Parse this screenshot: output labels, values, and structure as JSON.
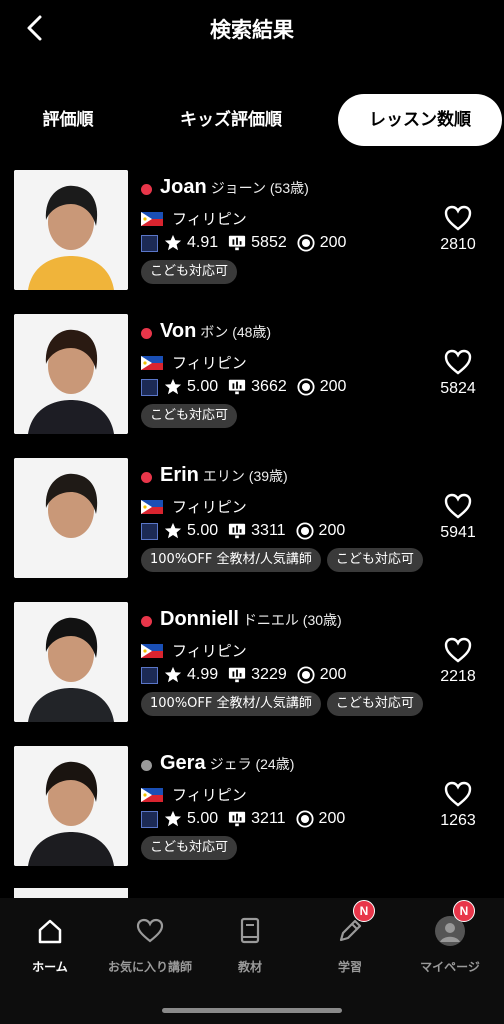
{
  "header": {
    "title": "検索結果"
  },
  "tabs": [
    {
      "label": "評価順"
    },
    {
      "label": "キッズ評価順"
    },
    {
      "label": "レッスン数順"
    }
  ],
  "colors": {
    "online": "#e8364a",
    "offline": "#9a9a9a",
    "active_tab_bg": "#ffffff"
  },
  "teachers": [
    {
      "name": "Joan",
      "kana": "ジョーン",
      "age": "(53歳)",
      "status": "online",
      "country": "フィリピン",
      "rating": "4.91",
      "lessons": "5852",
      "coins": "200",
      "tags": [
        "こども対応可"
      ],
      "favorites": "2810"
    },
    {
      "name": "Von",
      "kana": "ボン",
      "age": "(48歳)",
      "status": "online",
      "country": "フィリピン",
      "rating": "5.00",
      "lessons": "3662",
      "coins": "200",
      "tags": [
        "こども対応可"
      ],
      "favorites": "5824"
    },
    {
      "name": "Erin",
      "kana": "エリン",
      "age": "(39歳)",
      "status": "online",
      "country": "フィリピン",
      "rating": "5.00",
      "lessons": "3311",
      "coins": "200",
      "tags": [
        "100%OFF 全教材/人気講師",
        "こども対応可"
      ],
      "favorites": "5941"
    },
    {
      "name": "Donniell",
      "kana": "ドニエル",
      "age": "(30歳)",
      "status": "online",
      "country": "フィリピン",
      "rating": "4.99",
      "lessons": "3229",
      "coins": "200",
      "tags": [
        "100%OFF 全教材/人気講師",
        "こども対応可"
      ],
      "favorites": "2218"
    },
    {
      "name": "Gera",
      "kana": "ジェラ",
      "age": "(24歳)",
      "status": "offline",
      "country": "フィリピン",
      "rating": "5.00",
      "lessons": "3211",
      "coins": "200",
      "tags": [
        "こども対応可"
      ],
      "favorites": "1263"
    }
  ],
  "nav": [
    {
      "label": "ホーム",
      "icon": "home-icon"
    },
    {
      "label": "お気に入り講師",
      "icon": "heart-icon"
    },
    {
      "label": "教材",
      "icon": "book-icon"
    },
    {
      "label": "学習",
      "icon": "pencil-icon",
      "badge": "N"
    },
    {
      "label": "マイページ",
      "icon": "avatar",
      "badge": "N"
    }
  ]
}
